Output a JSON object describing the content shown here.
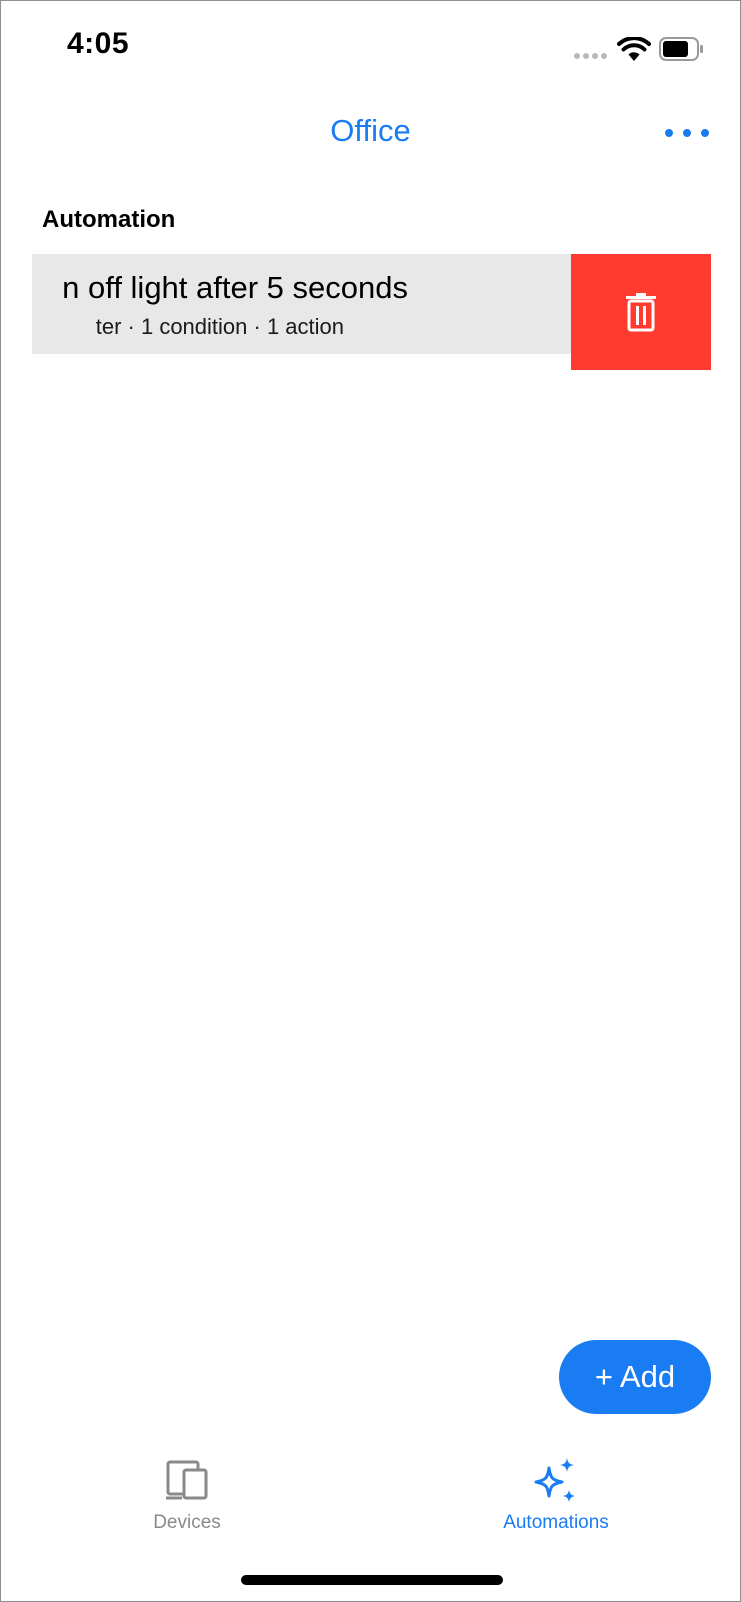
{
  "status_bar": {
    "time": "4:05"
  },
  "nav": {
    "title": "Office"
  },
  "section": {
    "header": "Automation"
  },
  "automations": [
    {
      "title_visible": "n off light after 5 seconds",
      "subtitle_visible": "ter · 1 condition · 1 action"
    }
  ],
  "add_button": {
    "label": "+ Add"
  },
  "tabs": [
    {
      "label": "Devices",
      "icon": "devices-icon",
      "selected": false
    },
    {
      "label": "Automations",
      "icon": "sparkles-icon",
      "selected": true
    }
  ],
  "colors": {
    "accent": "#1a7cf2",
    "destructive": "#ff3b30",
    "row_background": "#e8e8e8",
    "inactive_tab": "#8a8a8a"
  }
}
